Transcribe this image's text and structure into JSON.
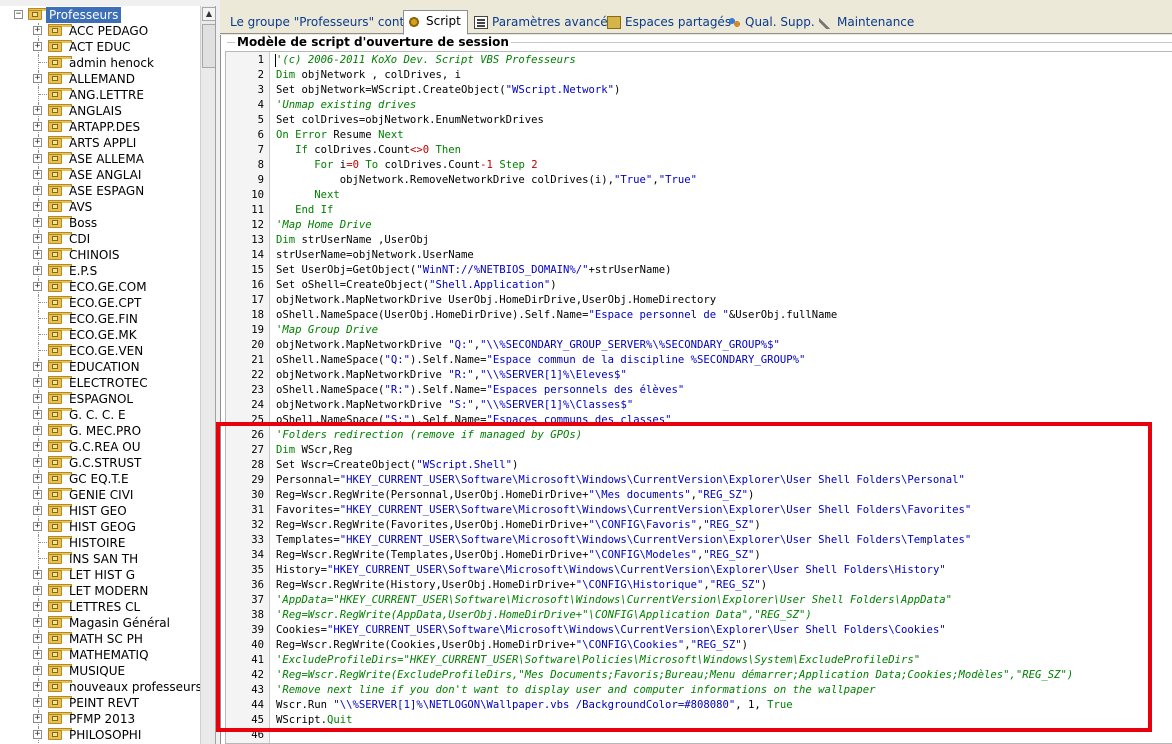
{
  "tree": {
    "root": "Professeurs",
    "items": [
      {
        "label": "ACC PEDAGO",
        "expandable": true
      },
      {
        "label": "ACT EDUC",
        "expandable": true
      },
      {
        "label": "admin henock",
        "expandable": false
      },
      {
        "label": "ALLEMAND",
        "expandable": true
      },
      {
        "label": "ANG.LETTRE",
        "expandable": false
      },
      {
        "label": "ANGLAIS",
        "expandable": true
      },
      {
        "label": "ARTAPP.DES",
        "expandable": true
      },
      {
        "label": "ARTS APPLI",
        "expandable": true
      },
      {
        "label": "ASE ALLEMA",
        "expandable": true
      },
      {
        "label": "ASE ANGLAI",
        "expandable": true
      },
      {
        "label": "ASE ESPAGN",
        "expandable": true
      },
      {
        "label": "AVS",
        "expandable": true
      },
      {
        "label": "Boss",
        "expandable": true
      },
      {
        "label": "CDI",
        "expandable": true
      },
      {
        "label": "CHINOIS",
        "expandable": true
      },
      {
        "label": "E.P.S",
        "expandable": true
      },
      {
        "label": "ECO.GE.COM",
        "expandable": true
      },
      {
        "label": "ECO.GE.CPT",
        "expandable": false
      },
      {
        "label": "ECO.GE.FIN",
        "expandable": false
      },
      {
        "label": "ECO.GE.MK",
        "expandable": false
      },
      {
        "label": "ECO.GE.VEN",
        "expandable": false
      },
      {
        "label": "EDUCATION",
        "expandable": true
      },
      {
        "label": "ELECTROTEC",
        "expandable": true
      },
      {
        "label": "ESPAGNOL",
        "expandable": true
      },
      {
        "label": "G. C. C. E",
        "expandable": true
      },
      {
        "label": "G. MEC.PRO",
        "expandable": true
      },
      {
        "label": "G.C.REA OU",
        "expandable": true
      },
      {
        "label": "G.C.STRUST",
        "expandable": true
      },
      {
        "label": "GC EQ.T.E",
        "expandable": true
      },
      {
        "label": "GENIE CIVI",
        "expandable": true
      },
      {
        "label": "HIST GEO",
        "expandable": true
      },
      {
        "label": "HIST GEOG",
        "expandable": true
      },
      {
        "label": "HISTOIRE",
        "expandable": false
      },
      {
        "label": "INS SAN TH",
        "expandable": false
      },
      {
        "label": "LET HIST G",
        "expandable": true
      },
      {
        "label": "LET MODERN",
        "expandable": true
      },
      {
        "label": "LETTRES CL",
        "expandable": true
      },
      {
        "label": "Magasin Général",
        "expandable": true
      },
      {
        "label": "MATH SC PH",
        "expandable": true
      },
      {
        "label": "MATHEMATIQ",
        "expandable": true
      },
      {
        "label": "MUSIQUE",
        "expandable": true
      },
      {
        "label": "nouveaux professeurs",
        "expandable": true
      },
      {
        "label": "PEINT REVT",
        "expandable": true
      },
      {
        "label": "PFMP 2013",
        "expandable": true
      },
      {
        "label": "PHILOSOPHI",
        "expandable": true
      }
    ]
  },
  "tabs": [
    {
      "label": "Le groupe \"Professeurs\" contient",
      "icon": "none",
      "active": false
    },
    {
      "label": "Script",
      "icon": "script-gear-icon",
      "active": true
    },
    {
      "label": "Paramètres avancés",
      "icon": "settings-list-icon",
      "active": false
    },
    {
      "label": "Espaces partagés",
      "icon": "shared-folder-icon",
      "active": false
    },
    {
      "label": "Qual. Supp.",
      "icon": "users-icon",
      "active": false
    },
    {
      "label": "Maintenance",
      "icon": "wrench-icon",
      "active": false
    }
  ],
  "editor": {
    "title": "Modèle de script d'ouverture de session",
    "lines": [
      {
        "n": "1",
        "segs": [
          [
            "c",
            "'(c) 2006-2011 KoXo Dev. Script VBS Professeurs"
          ]
        ]
      },
      {
        "n": "2",
        "segs": [
          [
            "k",
            "Dim"
          ],
          [
            "t",
            " objNetwork , colDrives, i"
          ]
        ]
      },
      {
        "n": "3",
        "segs": [
          [
            "t",
            "Set objNetwork=WScript.CreateObject("
          ],
          [
            "s",
            "\"WScript.Network\""
          ],
          [
            "t",
            ")"
          ]
        ]
      },
      {
        "n": "4",
        "segs": [
          [
            "c",
            "'Unmap existing drives"
          ]
        ]
      },
      {
        "n": "5",
        "segs": [
          [
            "t",
            "Set colDrives=objNetwork.EnumNetworkDrives"
          ]
        ]
      },
      {
        "n": "6",
        "segs": [
          [
            "k",
            "On Error"
          ],
          [
            "t",
            " Resume "
          ],
          [
            "k",
            "Next"
          ]
        ]
      },
      {
        "n": "7",
        "segs": [
          [
            "t",
            "   "
          ],
          [
            "k",
            "If"
          ],
          [
            "t",
            " colDrives.Count"
          ],
          [
            "o",
            "<>0"
          ],
          [
            "t",
            " "
          ],
          [
            "k",
            "Then"
          ]
        ]
      },
      {
        "n": "8",
        "segs": [
          [
            "t",
            "      "
          ],
          [
            "k",
            "For"
          ],
          [
            "t",
            " i"
          ],
          [
            "o",
            "=0"
          ],
          [
            "t",
            " "
          ],
          [
            "k",
            "To"
          ],
          [
            "t",
            " colDrives.Count"
          ],
          [
            "o",
            "-1"
          ],
          [
            "t",
            " "
          ],
          [
            "k",
            "Step"
          ],
          [
            "t",
            " "
          ],
          [
            "o",
            "2"
          ]
        ]
      },
      {
        "n": "9",
        "segs": [
          [
            "t",
            "          objNetwork.RemoveNetworkDrive colDrives(i),"
          ],
          [
            "s",
            "\"True\""
          ],
          [
            "t",
            ","
          ],
          [
            "s",
            "\"True\""
          ]
        ]
      },
      {
        "n": "10",
        "segs": [
          [
            "t",
            "      "
          ],
          [
            "k",
            "Next"
          ]
        ]
      },
      {
        "n": "11",
        "segs": [
          [
            "t",
            "   "
          ],
          [
            "k",
            "End If"
          ]
        ]
      },
      {
        "n": "12",
        "segs": [
          [
            "c",
            "'Map Home Drive"
          ]
        ]
      },
      {
        "n": "13",
        "segs": [
          [
            "k",
            "Dim"
          ],
          [
            "t",
            " strUserName ,UserObj"
          ]
        ]
      },
      {
        "n": "14",
        "segs": [
          [
            "t",
            "strUserName=objNetwork.UserName"
          ]
        ]
      },
      {
        "n": "15",
        "segs": [
          [
            "t",
            "Set UserObj=GetObject("
          ],
          [
            "s",
            "\"WinNT://%NETBIOS_DOMAIN%/\""
          ],
          [
            "t",
            "+strUserName)"
          ]
        ]
      },
      {
        "n": "16",
        "segs": [
          [
            "t",
            "Set oShell=CreateObject("
          ],
          [
            "s",
            "\"Shell.Application\""
          ],
          [
            "t",
            ")"
          ]
        ]
      },
      {
        "n": "17",
        "segs": [
          [
            "t",
            "objNetwork.MapNetworkDrive UserObj.HomeDirDrive,UserObj.HomeDirectory"
          ]
        ]
      },
      {
        "n": "18",
        "segs": [
          [
            "t",
            "oShell.NameSpace(UserObj.HomeDirDrive).Self.Name="
          ],
          [
            "s",
            "\"Espace personnel de \""
          ],
          [
            "t",
            "&UserObj.fullName"
          ]
        ]
      },
      {
        "n": "19",
        "segs": [
          [
            "c",
            "'Map Group Drive"
          ]
        ]
      },
      {
        "n": "20",
        "segs": [
          [
            "t",
            "objNetwork.MapNetworkDrive "
          ],
          [
            "s",
            "\"Q:\""
          ],
          [
            "t",
            ","
          ],
          [
            "s",
            "\"\\\\%SECONDARY_GROUP_SERVER%\\%SECONDARY_GROUP%$\""
          ]
        ]
      },
      {
        "n": "21",
        "segs": [
          [
            "t",
            "oShell.NameSpace("
          ],
          [
            "s",
            "\"Q:\""
          ],
          [
            "t",
            ").Self.Name="
          ],
          [
            "s",
            "\"Espace commun de la discipline %SECONDARY_GROUP%\""
          ]
        ]
      },
      {
        "n": "22",
        "segs": [
          [
            "t",
            "objNetwork.MapNetworkDrive "
          ],
          [
            "s",
            "\"R:\""
          ],
          [
            "t",
            ","
          ],
          [
            "s",
            "\"\\\\%SERVER[1]%\\Eleves$\""
          ]
        ]
      },
      {
        "n": "23",
        "segs": [
          [
            "t",
            "oShell.NameSpace("
          ],
          [
            "s",
            "\"R:\""
          ],
          [
            "t",
            ").Self.Name="
          ],
          [
            "s",
            "\"Espaces personnels des élèves\""
          ]
        ]
      },
      {
        "n": "24",
        "segs": [
          [
            "t",
            "objNetwork.MapNetworkDrive "
          ],
          [
            "s",
            "\"S:\""
          ],
          [
            "t",
            ","
          ],
          [
            "s",
            "\"\\\\%SERVER[1]%\\Classes$\""
          ]
        ]
      },
      {
        "n": "25",
        "segs": [
          [
            "t",
            "oShell.NameSpace("
          ],
          [
            "s",
            "\"S:\""
          ],
          [
            "t",
            ").Self.Name="
          ],
          [
            "s",
            "\"Espaces communs des classes\""
          ]
        ]
      },
      {
        "n": "26",
        "segs": [
          [
            "c",
            "'Folders redirection (remove if managed by GPOs)"
          ]
        ]
      },
      {
        "n": "27",
        "segs": [
          [
            "k",
            "Dim"
          ],
          [
            "t",
            " WScr,Reg"
          ]
        ]
      },
      {
        "n": "28",
        "segs": [
          [
            "t",
            "Set Wscr=CreateObject("
          ],
          [
            "s",
            "\"WScript.Shell\""
          ],
          [
            "t",
            ")"
          ]
        ]
      },
      {
        "n": "29",
        "segs": [
          [
            "t",
            "Personnal="
          ],
          [
            "s",
            "\"HKEY_CURRENT_USER\\Software\\Microsoft\\Windows\\CurrentVersion\\Explorer\\User Shell Folders\\Personal\""
          ]
        ]
      },
      {
        "n": "30",
        "segs": [
          [
            "t",
            "Reg=Wscr.RegWrite(Personnal,UserObj.HomeDirDrive+"
          ],
          [
            "s",
            "\"\\Mes documents\""
          ],
          [
            "t",
            ","
          ],
          [
            "s",
            "\"REG_SZ\""
          ],
          [
            "t",
            ")"
          ]
        ]
      },
      {
        "n": "31",
        "segs": [
          [
            "t",
            "Favorites="
          ],
          [
            "s",
            "\"HKEY_CURRENT_USER\\Software\\Microsoft\\Windows\\CurrentVersion\\Explorer\\User Shell Folders\\Favorites\""
          ]
        ]
      },
      {
        "n": "32",
        "segs": [
          [
            "t",
            "Reg=Wscr.RegWrite(Favorites,UserObj.HomeDirDrive+"
          ],
          [
            "s",
            "\"\\CONFIG\\Favoris\""
          ],
          [
            "t",
            ","
          ],
          [
            "s",
            "\"REG_SZ\""
          ],
          [
            "t",
            ")"
          ]
        ]
      },
      {
        "n": "33",
        "segs": [
          [
            "t",
            "Templates="
          ],
          [
            "s",
            "\"HKEY_CURRENT_USER\\Software\\Microsoft\\Windows\\CurrentVersion\\Explorer\\User Shell Folders\\Templates\""
          ]
        ]
      },
      {
        "n": "34",
        "segs": [
          [
            "t",
            "Reg=Wscr.RegWrite(Templates,UserObj.HomeDirDrive+"
          ],
          [
            "s",
            "\"\\CONFIG\\Modeles\""
          ],
          [
            "t",
            ","
          ],
          [
            "s",
            "\"REG_SZ\""
          ],
          [
            "t",
            ")"
          ]
        ]
      },
      {
        "n": "35",
        "segs": [
          [
            "t",
            "History="
          ],
          [
            "s",
            "\"HKEY_CURRENT_USER\\Software\\Microsoft\\Windows\\CurrentVersion\\Explorer\\User Shell Folders\\History\""
          ]
        ]
      },
      {
        "n": "36",
        "segs": [
          [
            "t",
            "Reg=Wscr.RegWrite(History,UserObj.HomeDirDrive+"
          ],
          [
            "s",
            "\"\\CONFIG\\Historique\""
          ],
          [
            "t",
            ","
          ],
          [
            "s",
            "\"REG_SZ\""
          ],
          [
            "t",
            ")"
          ]
        ]
      },
      {
        "n": "37",
        "segs": [
          [
            "c",
            "'AppData=\"HKEY_CURRENT_USER\\Software\\Microsoft\\Windows\\CurrentVersion\\Explorer\\User Shell Folders\\AppData\""
          ]
        ]
      },
      {
        "n": "38",
        "segs": [
          [
            "c",
            "'Reg=Wscr.RegWrite(AppData,UserObj.HomeDirDrive+\"\\CONFIG\\Application Data\",\"REG_SZ\")"
          ]
        ]
      },
      {
        "n": "39",
        "segs": [
          [
            "t",
            "Cookies="
          ],
          [
            "s",
            "\"HKEY_CURRENT_USER\\Software\\Microsoft\\Windows\\CurrentVersion\\Explorer\\User Shell Folders\\Cookies\""
          ]
        ]
      },
      {
        "n": "40",
        "segs": [
          [
            "t",
            "Reg=Wscr.RegWrite(Cookies,UserObj.HomeDirDrive+"
          ],
          [
            "s",
            "\"\\CONFIG\\Cookies\""
          ],
          [
            "t",
            ","
          ],
          [
            "s",
            "\"REG_SZ\""
          ],
          [
            "t",
            ")"
          ]
        ]
      },
      {
        "n": "41",
        "segs": [
          [
            "c",
            "'ExcludeProfileDirs=\"HKEY_CURRENT_USER\\Software\\Policies\\Microsoft\\Windows\\System\\ExcludeProfileDirs\""
          ]
        ]
      },
      {
        "n": "42",
        "segs": [
          [
            "c",
            "'Reg=Wscr.RegWrite(ExcludeProfileDirs,\"Mes Documents;Favoris;Bureau;Menu démarrer;Application Data;Cookies;Modèles\",\"REG_SZ\")"
          ]
        ]
      },
      {
        "n": "43",
        "segs": [
          [
            "c",
            "'Remove next line if you don't want to display user and computer informations on the wallpaper"
          ]
        ]
      },
      {
        "n": "44",
        "segs": [
          [
            "t",
            "Wscr.Run "
          ],
          [
            "s",
            "\"\\\\%SERVER[1]%\\NETLOGON\\Wallpaper.vbs /BackgroundColor=#808080\""
          ],
          [
            "t",
            ", 1, "
          ],
          [
            "k",
            "True"
          ]
        ]
      },
      {
        "n": "45",
        "segs": [
          [
            "t",
            "WScript."
          ],
          [
            "k",
            "Quit"
          ]
        ]
      },
      {
        "n": "46",
        "segs": [
          [
            "t",
            ""
          ]
        ]
      }
    ]
  },
  "colors": {
    "highlight": "#e8000c",
    "comment": "#008000",
    "string": "#0000c0",
    "selection": "#3d6fb6"
  }
}
